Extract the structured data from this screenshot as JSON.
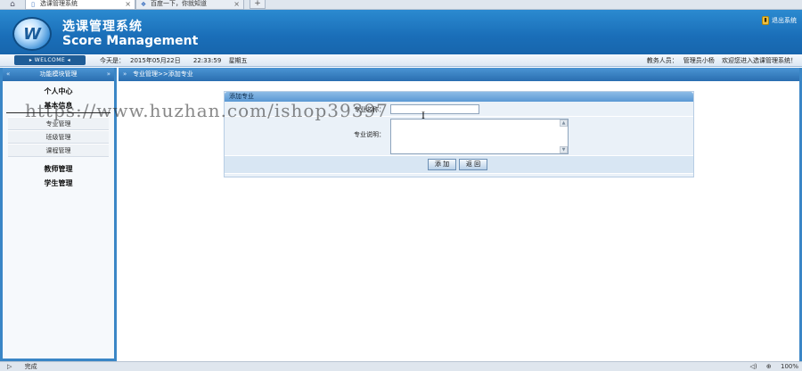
{
  "browser": {
    "tabs": [
      {
        "title": "选课管理系统",
        "close": "×",
        "active": true
      },
      {
        "title": "百度一下，你就知道",
        "close": "×",
        "active": false
      }
    ],
    "new_tab": "+",
    "status_left": "完成",
    "zoom": "100%"
  },
  "header": {
    "logo_letter": "W",
    "title_cn": "选课管理系统",
    "title_en": "Score Management",
    "logout": "退出系统"
  },
  "status": {
    "welcome": "WELCOME",
    "today_label": "今天是：",
    "date": "2015年05月22日",
    "time": "22:33:59",
    "weekday": "星期五",
    "user_label": "教务人员：",
    "user_name": "管理员小杨",
    "greeting": "欢迎您进入选课管理系统！"
  },
  "sidebar": {
    "title": "功能模块管理",
    "groups": [
      {
        "label": "个人中心"
      },
      {
        "label": "基本信息",
        "items": [
          "专业管理",
          "班级管理",
          "课程管理"
        ]
      },
      {
        "label": "教师管理"
      },
      {
        "label": "学生管理"
      }
    ]
  },
  "main": {
    "breadcrumb": "专业管理>>添加专业",
    "panel_title": "添加专业",
    "name_label": "专业名称：",
    "name_value": "",
    "desc_label": "专业说明：",
    "desc_value": "",
    "add_button": "添 加",
    "back_button": "返 回"
  },
  "watermark": "https://www.huzhan.com/ishop39397",
  "icons": {
    "home": "home-icon",
    "lock": "lock-icon",
    "arrow": "double-arrow-icon"
  },
  "colors": {
    "header_blue": "#1a6eb8",
    "border_blue": "#3a86c6",
    "panel_bg": "#eaf1f8"
  }
}
